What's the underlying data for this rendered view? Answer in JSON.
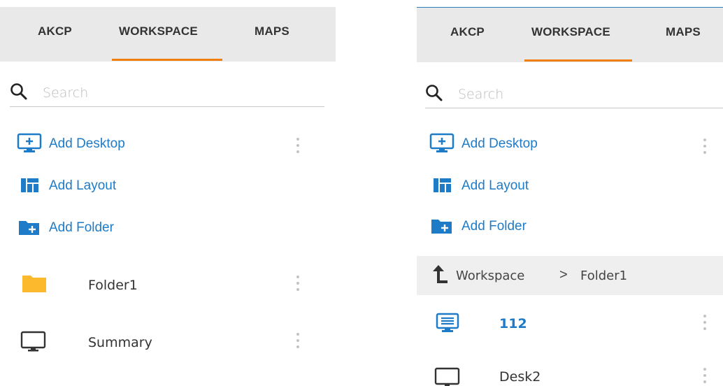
{
  "colors": {
    "accent": "#1e7bc8",
    "tab_underline": "#f07f0f",
    "folder": "#fdb92e",
    "tabbar_bg": "#e9e9e9"
  },
  "left": {
    "tabs": [
      {
        "label": "AKCP",
        "active": false
      },
      {
        "label": "WORKSPACE",
        "active": true
      },
      {
        "label": "MAPS",
        "active": false
      }
    ],
    "search": {
      "placeholder": "Search",
      "icon": "search-icon"
    },
    "actions": {
      "add_desktop": {
        "label": "Add Desktop",
        "icon": "add-desktop-icon"
      },
      "add_layout": {
        "label": "Add Layout",
        "icon": "layout-icon"
      },
      "add_folder": {
        "label": "Add Folder",
        "icon": "add-folder-icon"
      }
    },
    "items": [
      {
        "label": "Folder1",
        "icon": "folder-icon"
      },
      {
        "label": "Summary",
        "icon": "monitor-icon"
      }
    ]
  },
  "right": {
    "tabs": [
      {
        "label": "AKCP",
        "active": false
      },
      {
        "label": "WORKSPACE",
        "active": true
      },
      {
        "label": "MAPS",
        "active": false
      }
    ],
    "search": {
      "placeholder": "Search",
      "icon": "search-icon"
    },
    "actions": {
      "add_desktop": {
        "label": "Add Desktop",
        "icon": "add-desktop-icon"
      },
      "add_layout": {
        "label": "Add Layout",
        "icon": "layout-icon"
      },
      "add_folder": {
        "label": "Add Folder",
        "icon": "add-folder-icon"
      }
    },
    "breadcrumb": {
      "parent": "Workspace",
      "separator": ">",
      "current": "Folder1",
      "up_icon": "level-up-icon"
    },
    "items": [
      {
        "label": "112",
        "icon": "desktop-list-icon",
        "selected": true
      },
      {
        "label": "Desk2",
        "icon": "monitor-icon",
        "selected": false
      }
    ]
  }
}
